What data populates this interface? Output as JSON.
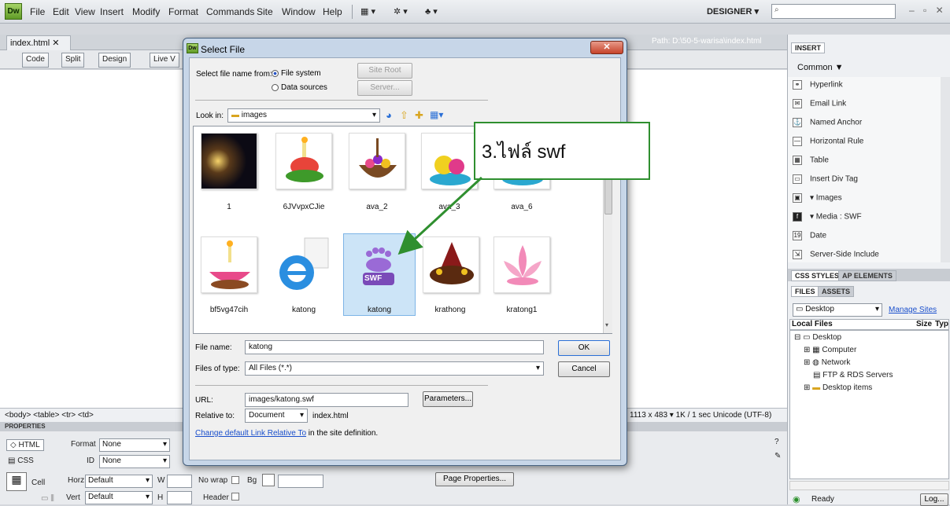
{
  "menubar": {
    "logo": "Dw",
    "items": [
      "File",
      "Edit",
      "View",
      "Insert",
      "Modify",
      "Format",
      "Commands",
      "Site",
      "Window",
      "Help"
    ],
    "workspace": "DESIGNER ▾",
    "window_controls": "– ▫ ✕"
  },
  "document": {
    "tab": "index.html",
    "close": "✕",
    "path": "Path: D:\\50-5-warisa\\index.html",
    "views": [
      "Code",
      "Split",
      "Design",
      "Live V"
    ]
  },
  "statusbar": {
    "tags": "<body> <table> <tr> <td>",
    "size": "1113 x 483 ▾  1K / 1 sec  Unicode (UTF-8)"
  },
  "properties": {
    "title": "PROPERTIES",
    "html": "HTML",
    "css": "CSS",
    "format_label": "Format",
    "format_value": "None",
    "id_label": "ID",
    "id_value": "None",
    "cell": "Cell",
    "horz_label": "Horz",
    "horz_value": "Default",
    "vert_label": "Vert",
    "vert_value": "Default",
    "w_label": "W",
    "h_label": "H",
    "nowrap": "No wrap",
    "bg": "Bg",
    "header": "Header",
    "page_props": "Page Properties..."
  },
  "insert_panel": {
    "tab": "INSERT",
    "category": "Common ▼",
    "items": [
      "Hyperlink",
      "Email Link",
      "Named Anchor",
      "Horizontal Rule",
      "Table",
      "Insert Div Tag",
      "▾ Images",
      "▾ Media : SWF",
      "Date",
      "Server-Side Include"
    ]
  },
  "css_panel": {
    "tabs": [
      "CSS STYLES",
      "AP ELEMENTS"
    ]
  },
  "files_panel": {
    "tabs": [
      "FILES",
      "ASSETS"
    ],
    "site": "Desktop",
    "manage": "Manage Sites",
    "col_local": "Local Files",
    "col_size": "Size",
    "col_type": "Typ",
    "tree": [
      "Desktop",
      "Computer",
      "Network",
      "FTP & RDS Servers",
      "Desktop items"
    ],
    "status": "Ready",
    "log": "Log..."
  },
  "dialog": {
    "title": "Select File",
    "logo": "Dw",
    "close": "✕",
    "select_from": "Select file name from:",
    "opt_fs": "File system",
    "opt_ds": "Data sources",
    "site_root": "Site Root",
    "server": "Server...",
    "look_in_label": "Look in:",
    "look_in_value": "images",
    "files": [
      {
        "name": "1"
      },
      {
        "name": "6JVvpxCJie"
      },
      {
        "name": "ava_2"
      },
      {
        "name": "ava_3"
      },
      {
        "name": "ava_6"
      },
      {
        "name": "bf5vg47cih"
      },
      {
        "name": "katong"
      },
      {
        "name": "katong"
      },
      {
        "name": "krathong"
      },
      {
        "name": "kratong1"
      }
    ],
    "swf_label": "SWF",
    "file_name_label": "File name:",
    "file_name_value": "katong",
    "file_type_label": "Files of type:",
    "file_type_value": "All Files (*.*)",
    "ok": "OK",
    "cancel": "Cancel",
    "url_label": "URL:",
    "url_value": "images/katong.swf",
    "parameters": "Parameters...",
    "relative_label": "Relative to:",
    "relative_value": "Document",
    "relative_file": "index.html",
    "change_link": "Change default Link Relative To",
    "change_rest": " in the site definition."
  },
  "callout": {
    "text": "3.ไฟล์ swf"
  }
}
